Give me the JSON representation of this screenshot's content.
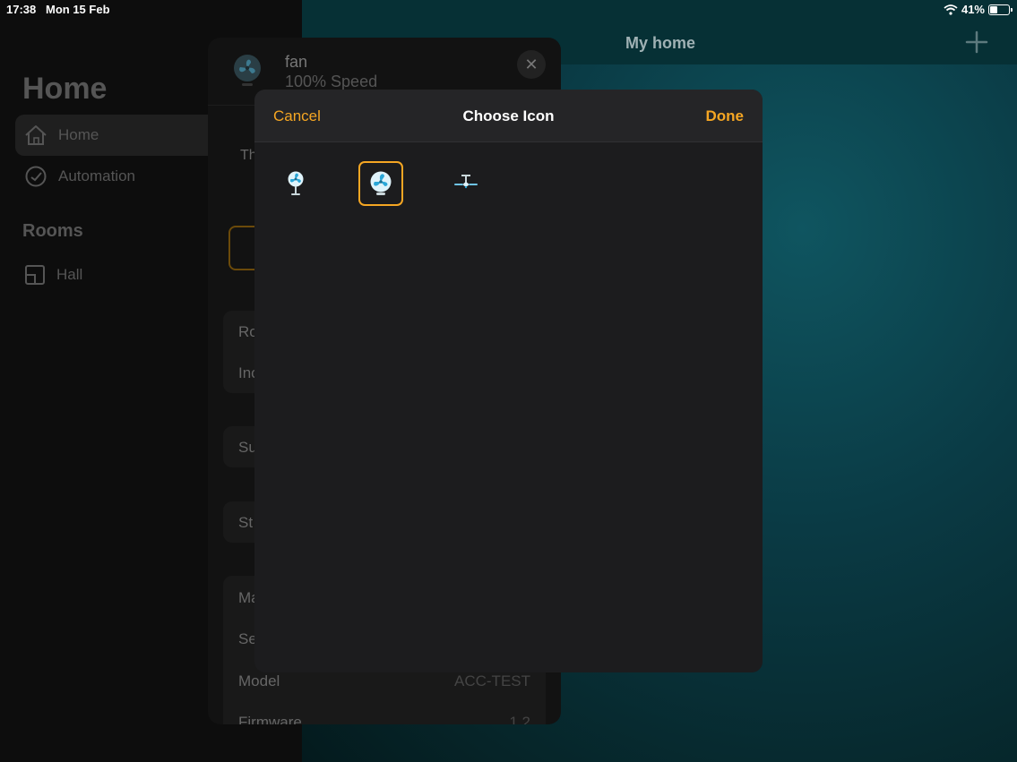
{
  "status_bar": {
    "time": "17:38",
    "date": "Mon 15 Feb",
    "battery": "41%",
    "battery_level": 0.41
  },
  "sidebar": {
    "title": "Home",
    "items": [
      {
        "label": "Home",
        "icon": "house-icon",
        "active": true
      },
      {
        "label": "Automation",
        "icon": "clock-icon",
        "active": false
      }
    ],
    "rooms_heading": "Rooms",
    "rooms": [
      {
        "label": "Hall",
        "icon": "room-icon"
      }
    ]
  },
  "main": {
    "title": "My home"
  },
  "accessory": {
    "name": "fan",
    "status": "100% Speed",
    "partial_text": "Th",
    "rows_group1": [
      "Ro",
      "Inc"
    ],
    "row_su": "Su",
    "row_st": "St",
    "info_rows": [
      {
        "label": "Ma",
        "value": ""
      },
      {
        "label": "Se",
        "value": ""
      },
      {
        "label": "Model",
        "value": "ACC-TEST"
      },
      {
        "label": "Firmware",
        "value": "1.2"
      }
    ]
  },
  "modal": {
    "cancel": "Cancel",
    "title": "Choose Icon",
    "done": "Done",
    "accent": "#f5a623",
    "icons": [
      {
        "name": "desk-fan-icon",
        "selected": false
      },
      {
        "name": "fan-icon",
        "selected": true
      },
      {
        "name": "ceiling-fan-icon",
        "selected": false
      }
    ]
  }
}
